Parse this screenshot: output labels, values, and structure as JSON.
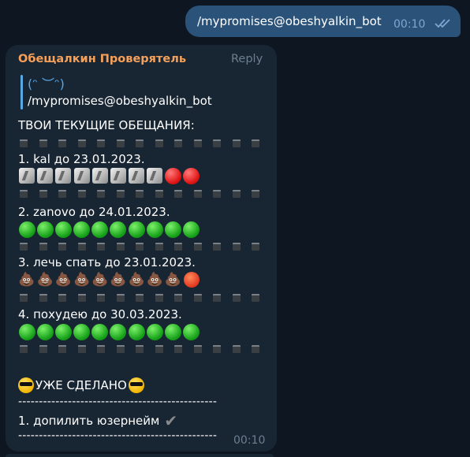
{
  "outgoing": {
    "text": "/mypromises@obeshyalkin_bot",
    "time": "00:10",
    "status_icon": "double-check-icon"
  },
  "incoming": {
    "sender": "Обещалкин Проверятель",
    "reply_label": "Reply",
    "quote": {
      "emoji_face": "(ᵔ ︶ᵔ)",
      "text": "/mypromises@obeshyalkin_bot"
    },
    "header": "ТВОИ ТЕКУЩИЕ ОБЕЩАНИЯ:",
    "promises": [
      {
        "text": "1.  kal до 23.01.2023.",
        "marks": [
          "tile",
          "tile",
          "tile",
          "tile",
          "tile",
          "tile",
          "tile",
          "tile",
          "red",
          "red"
        ]
      },
      {
        "text": "2.  zanovo до 24.01.2023.",
        "marks": [
          "green",
          "green",
          "green",
          "green",
          "green",
          "green",
          "green",
          "green",
          "green",
          "green"
        ]
      },
      {
        "text": "3.  лечь спать до 23.01.2023.",
        "marks": [
          "poop",
          "poop",
          "poop",
          "poop",
          "poop",
          "poop",
          "poop",
          "poop",
          "poop",
          "hot"
        ]
      },
      {
        "text": "4.  похудею до 30.03.2023.",
        "marks": [
          "green",
          "green",
          "green",
          "green",
          "green",
          "green",
          "green",
          "green",
          "green",
          "green"
        ]
      }
    ],
    "done_header": "УЖЕ СДЕЛАНО",
    "dash_line": "------------------------------------------------",
    "done_items": [
      {
        "text": "1.  допилить юзернейм",
        "icon": "check-mark-icon"
      }
    ],
    "time": "00:10"
  }
}
